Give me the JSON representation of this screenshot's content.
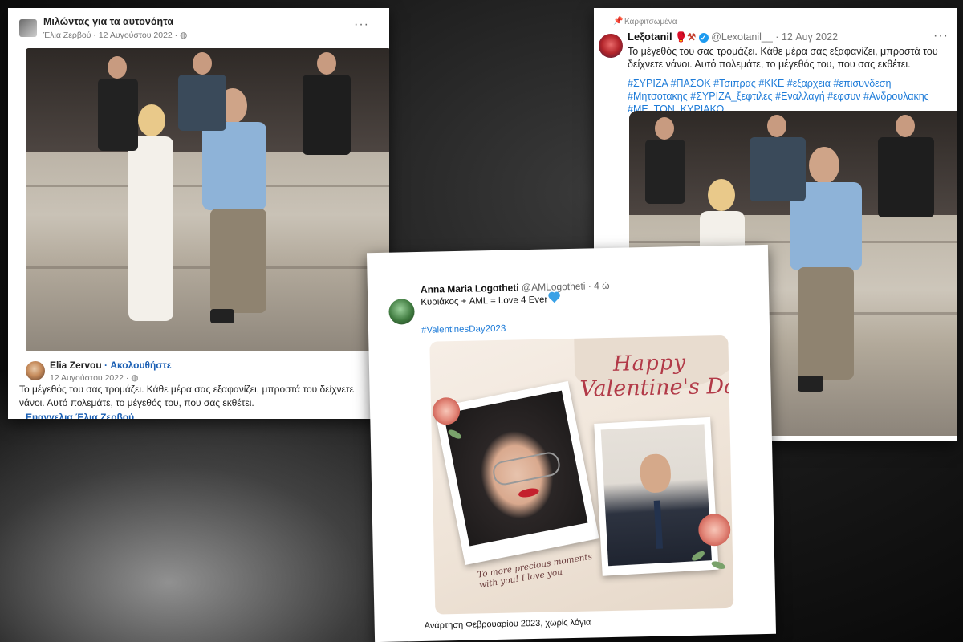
{
  "card1": {
    "group_name": "Μιλώντας για τα αυτονόητα",
    "group_meta": "Έλια Ζερβού · 12 Αυγούστου 2022 · ◍",
    "more": "···",
    "author_name": "Elia Zervou",
    "author_follow": " · Ακολουθήστε",
    "author_date": "12 Αυγούστου 2022 · ◍",
    "post_text": "Το μέγεθός του σας τρομάζει. Κάθε μέρα σας εξαφανίζει, μπροστά του δείχνετε νάνοι. Αυτό πολεμάτε, το μέγεθός του, που σας εκθέτει.",
    "signature": "Ευαγγελια Έλια Ζερβού"
  },
  "card2": {
    "pinned_label": "Καρφιτσωμένα",
    "name": "Lеξotanil",
    "emoji": "🥊⚒",
    "handle_date": "@Lexotanil__ · 12 Αυγ 2022",
    "more": "···",
    "body": "Το μέγεθός του σας τρομάζει. Κάθε μέρα σας εξαφανίζει, μπροστά του δείχνετε νάνοι. Αυτό πολεμάτε, το μέγεθός του, που σας εκθέτει.",
    "hashtags": "#ΣΥΡΙΖΑ #ΠΑΣΟΚ #Τσιπρας #ΚΚΕ #εξαρχεια #επισυνδεση #Μητσοτακης #ΣΥΡΙΖΑ_ξεφτιλες #Εναλλαγή #εφσυν #Ανδρουλακης #ΜΕ_ΤΟΝ_ΚΥΡΙΑΚΟ"
  },
  "card3": {
    "name": "Anna Maria Logotheti",
    "handle_time": "@AMLogotheti · 4 ώ",
    "text": "Κυριάκος + AML = Love 4 Ever",
    "hashtag": "#ValentinesDay2023",
    "image_happy": "Happy",
    "image_valentine": "Valentine's Day",
    "image_caption_1": "To more precious moments",
    "image_caption_2": "with you! I love you",
    "footer": "Ανάρτηση Φεβρουαρίου 2023, χωρίς λόγια"
  },
  "colors": {
    "link_blue": "#1a5fb4",
    "hashtag_blue": "#1d7bd8",
    "valentine_red": "#b23a48",
    "verified_blue": "#1d9bf0"
  }
}
